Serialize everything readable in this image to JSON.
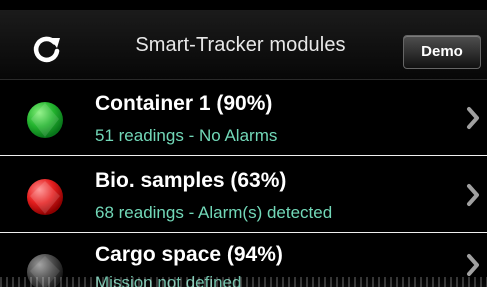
{
  "header": {
    "title": "Smart-Tracker modules",
    "demo_label": "Demo",
    "refresh_icon": "refresh-icon"
  },
  "modules": [
    {
      "title": "Container 1 (90%)",
      "subtitle": "51 readings - No Alarms",
      "status_color": "#35b83f",
      "status_icon": "green-status-icon",
      "chevron_icon": "chevron-right-icon"
    },
    {
      "title": "Bio. samples (63%)",
      "subtitle": "68 readings - Alarm(s) detected",
      "status_color": "#e7232a",
      "status_icon": "red-status-icon",
      "chevron_icon": "chevron-right-icon"
    },
    {
      "title": "Cargo space (94%)",
      "subtitle": "Mission not defined",
      "status_color": "#4a4a4a",
      "status_icon": "gray-status-icon",
      "chevron_icon": "chevron-right-icon"
    }
  ],
  "colors": {
    "background": "#000000",
    "primary_text": "#ffffff",
    "secondary_text": "#72d8b8",
    "divider": "#eeeeee",
    "chevron": "#9a9a9a"
  }
}
